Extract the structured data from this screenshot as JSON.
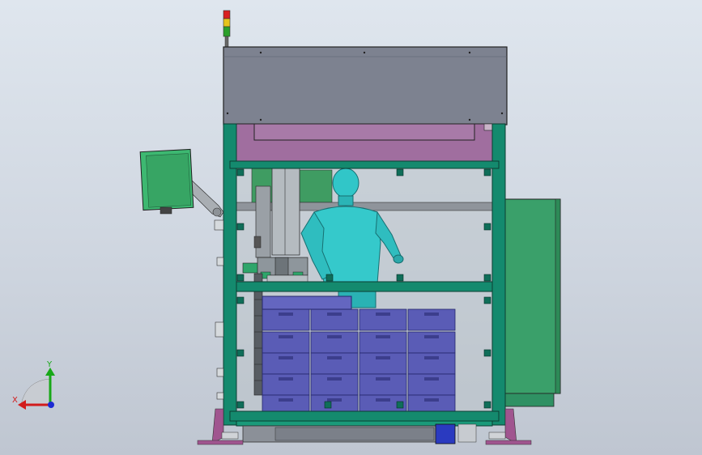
{
  "axes": {
    "x_label": "X",
    "y_label": "Y"
  },
  "colors": {
    "background": "#cfd6e0",
    "hood": "#7d8290",
    "fascia": "#a06e9f",
    "frame": "#148a6e",
    "panel_green": "#3aa06a",
    "totes": "#5a5cb6",
    "mannequin": "#31c6c8",
    "beacon_red": "#d92020",
    "beacon_yellow": "#e6c41a",
    "beacon_green": "#2aa02a",
    "feet": "#a0558f"
  },
  "icons": {
    "triad": "coordinate-triad-icon",
    "beacon": "signal-tower-icon"
  }
}
